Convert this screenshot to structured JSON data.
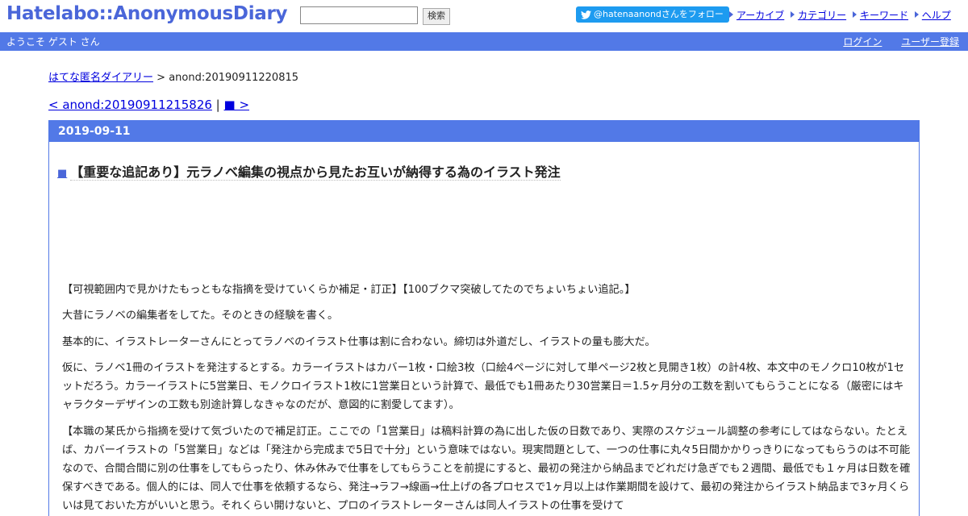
{
  "header": {
    "logo": "Hatelabo::AnonymousDiary",
    "search_placeholder": "",
    "search_button": "検索",
    "follow_button": "@hatenaanondさんをフォロー",
    "nav": [
      "アーカイブ",
      "カテゴリー",
      "キーワード",
      "ヘルプ"
    ],
    "twitter_color": "#1d9bf0",
    "accent_color": "#5279e7"
  },
  "band": {
    "welcome": "ようこそ ゲスト さん",
    "login": "ログイン",
    "register": "ユーザー登録"
  },
  "breadcrumb": {
    "home": "はてな匿名ダイアリー",
    "separator": " > ",
    "current": "anond:20190911220815"
  },
  "pager": {
    "prev": "< anond:20190911215826",
    "separator": " | ",
    "next": "■ >"
  },
  "day": {
    "date": "2019-09-11",
    "entry": {
      "marker": "■",
      "title": "【重要な追記あり】元ラノベ編集の視点から見たお互いが納得する為のイラスト発注",
      "paragraphs": [
        "【可視範囲内で見かけたもっともな指摘を受けていくらか補足・訂正】【100ブクマ突破してたのでちょいちょい追記。】",
        "大昔にラノベの編集者をしてた。そのときの経験を書く。",
        "基本的に、イラストレーターさんにとってラノベのイラスト仕事は割に合わない。締切は外道だし、イラストの量も膨大だ。",
        "仮に、ラノベ1冊のイラストを発注するとする。カラーイラストはカバー1枚・口絵3枚（口絵4ページに対して単ページ2枚と見開き1枚）の計4枚、本文中のモノクロ10枚が1セットだろう。カラーイラストに5営業日、モノクロイラスト1枚に1営業日という計算で、最低でも1冊あたり30営業日＝1.5ヶ月分の工数を割いてもらうことになる（厳密にはキャラクターデザインの工数も別途計算しなきゃなのだが、意図的に割愛してます）。",
        "【本職の某氏から指摘を受けて気づいたので補足訂正。ここでの「1営業日」は稿料計算の為に出した仮の日数であり、実際のスケジュール調整の参考にしてはならない。たとえば、カバーイラストの「5営業日」などは「発注から完成まで5日で十分」という意味ではない。現実問題として、一つの仕事に丸々5日間かかりっきりになってもらうのは不可能なので、合間合間に別の仕事をしてもらったり、休み休みで仕事をしてもらうことを前提にすると、最初の発注から納品までどれだけ急ぎでも２週間、最低でも１ヶ月は日数を確保すべきである。個人的には、同人で仕事を依頼するなら、発注→ラフ→線画→仕上げの各プロセスで1ヶ月以上は作業期間を設けて、最初の発注からイラスト納品まで3ヶ月くらいは見ておいた方がいいと思う。それくらい開けないと、プロのイラストレーターさんは同人イラストの仕事を受けて"
      ]
    }
  }
}
